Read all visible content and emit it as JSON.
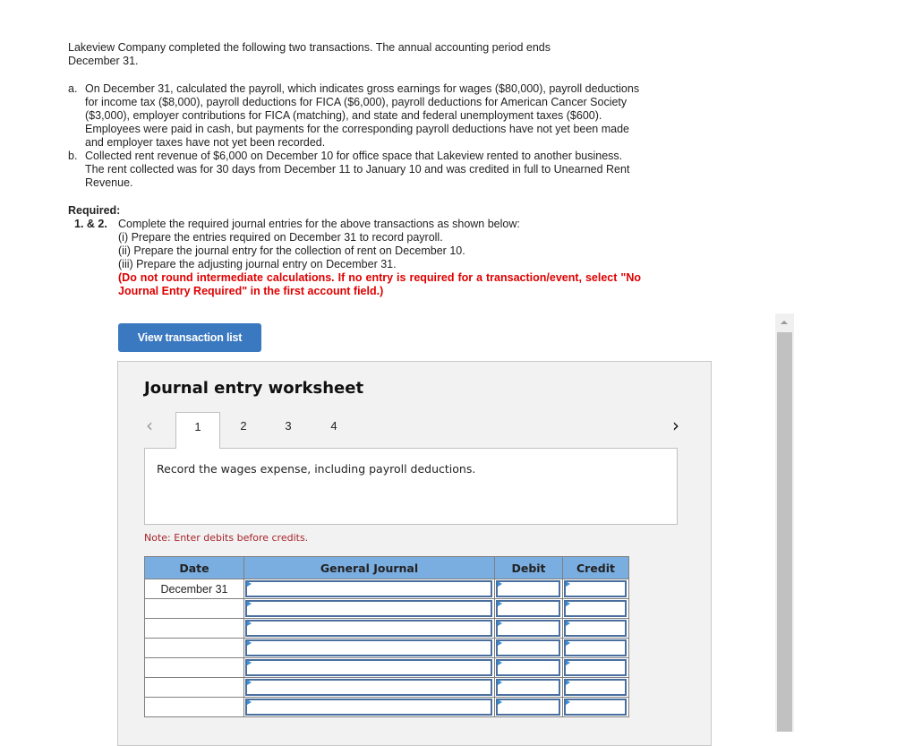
{
  "intro": "Lakeview Company completed the following two transactions. The annual accounting period ends December 31.",
  "transactions": [
    {
      "label": "a.",
      "text": "On December 31, calculated the payroll, which indicates gross earnings for wages ($80,000), payroll deductions for income tax ($8,000), payroll deductions for FICA ($6,000), payroll deductions for American Cancer Society ($3,000), employer contributions for FICA (matching), and state and federal unemployment taxes ($600). Employees were paid in cash, but payments for the corresponding payroll deductions have not yet been made and employer taxes have not yet been recorded."
    },
    {
      "label": "b.",
      "text": "Collected rent revenue of $6,000 on December 10 for office space that Lakeview rented to another business. The rent collected was for 30 days from December 11 to January 10 and was credited in full to Unearned Rent Revenue."
    }
  ],
  "required": {
    "title": "Required:",
    "number": "1. & 2.",
    "instruction": "Complete the required journal entries for the above transactions as shown below:",
    "steps": [
      "(i) Prepare the entries required on December 31 to record payroll.",
      "(ii) Prepare the journal entry for the collection of rent on December 10.",
      "(iii) Prepare the adjusting journal entry on December 31."
    ],
    "warning": "(Do not round intermediate calculations. If no entry is required for a transaction/event, select \"No Journal Entry Required\" in the first account field.)"
  },
  "view_button_label": "View transaction list",
  "worksheet": {
    "title": "Journal entry worksheet",
    "prev_icon": "chevron-left-icon",
    "next_icon": "chevron-right-icon",
    "tabs": [
      "1",
      "2",
      "3",
      "4"
    ],
    "active_tab": "1",
    "description": "Record the wages expense, including payroll deductions.",
    "note": "Note: Enter debits before credits.",
    "table": {
      "headers": [
        "Date",
        "General Journal",
        "Debit",
        "Credit"
      ],
      "rows": [
        {
          "date": "December 31",
          "account": "",
          "debit": "",
          "credit": ""
        },
        {
          "date": "",
          "account": "",
          "debit": "",
          "credit": ""
        },
        {
          "date": "",
          "account": "",
          "debit": "",
          "credit": ""
        },
        {
          "date": "",
          "account": "",
          "debit": "",
          "credit": ""
        },
        {
          "date": "",
          "account": "",
          "debit": "",
          "credit": ""
        },
        {
          "date": "",
          "account": "",
          "debit": "",
          "credit": ""
        },
        {
          "date": "",
          "account": "",
          "debit": "",
          "credit": ""
        }
      ]
    }
  },
  "colors": {
    "button_bg": "#3a78c0",
    "header_bg": "#7aade0",
    "warning_red": "#e00000",
    "note_red": "#a8232a",
    "input_border": "#4a6f9e"
  }
}
